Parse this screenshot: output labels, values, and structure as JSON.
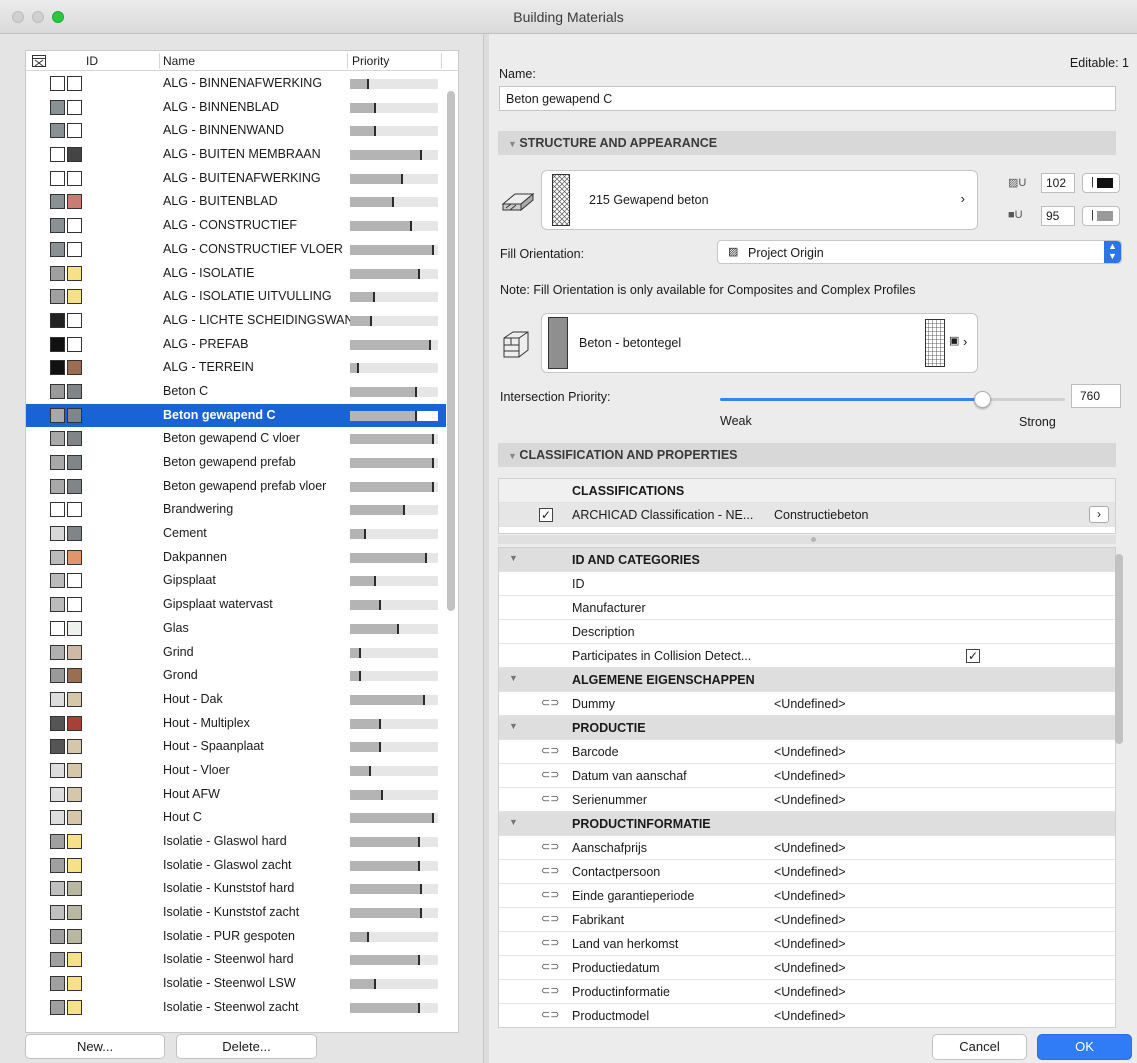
{
  "window": {
    "title": "Building Materials"
  },
  "list": {
    "headers": {
      "id": "ID",
      "name": "Name",
      "priority": "Priority"
    },
    "rows": [
      {
        "name": "ALG - BINNENAFWERKING",
        "c1": "#ffffff",
        "c2": "#ffffff",
        "p": 0.22
      },
      {
        "name": "ALG - BINNENBLAD",
        "c1": "#8a9194",
        "c2": "#ffffff",
        "p": 0.3
      },
      {
        "name": "ALG - BINNENWAND",
        "c1": "#8a9194",
        "c2": "#ffffff",
        "p": 0.3
      },
      {
        "name": "ALG - BUITEN MEMBRAAN",
        "c1": "#ffffff",
        "c2": "#444444",
        "p": 0.82
      },
      {
        "name": "ALG - BUITENAFWERKING",
        "c1": "#ffffff",
        "c2": "#ffffff",
        "p": 0.6
      },
      {
        "name": "ALG - BUITENBLAD",
        "c1": "#8a9194",
        "c2": "#c97c72",
        "p": 0.5
      },
      {
        "name": "ALG - CONSTRUCTIEF",
        "c1": "#8a9194",
        "c2": "#ffffff",
        "p": 0.7
      },
      {
        "name": "ALG - CONSTRUCTIEF VLOER",
        "c1": "#8a9194",
        "c2": "#ffffff",
        "p": 0.95
      },
      {
        "name": "ALG - ISOLATIE",
        "c1": "#a0a0a0",
        "c2": "#f7e08a",
        "p": 0.8
      },
      {
        "name": "ALG - ISOLATIE UITVULLING",
        "c1": "#a0a0a0",
        "c2": "#f7e08a",
        "p": 0.28
      },
      {
        "name": "ALG - LICHTE SCHEIDINGSWAND",
        "c1": "#222222",
        "c2": "#ffffff",
        "p": 0.25
      },
      {
        "name": "ALG - PREFAB",
        "c1": "#111111",
        "c2": "#ffffff",
        "p": 0.92
      },
      {
        "name": "ALG - TERREIN",
        "c1": "#111111",
        "c2": "#9b6d52",
        "p": 0.1
      },
      {
        "name": "Beton C",
        "c1": "#9a9a9a",
        "c2": "#808587",
        "p": 0.76
      },
      {
        "name": "Beton gewapend C",
        "c1": "#a8a8a8",
        "c2": "#808587",
        "p": 0.76
      },
      {
        "name": "Beton gewapend C vloer",
        "c1": "#a8a8a8",
        "c2": "#808587",
        "p": 0.95
      },
      {
        "name": "Beton gewapend prefab",
        "c1": "#a8a8a8",
        "c2": "#808587",
        "p": 0.95
      },
      {
        "name": "Beton gewapend prefab vloer",
        "c1": "#a8a8a8",
        "c2": "#808587",
        "p": 0.95
      },
      {
        "name": "Brandwering",
        "c1": "#ffffff",
        "c2": "#ffffff",
        "p": 0.62
      },
      {
        "name": "Cement",
        "c1": "#d8d8d8",
        "c2": "#808587",
        "p": 0.18
      },
      {
        "name": "Dakpannen",
        "c1": "#bbbbbb",
        "c2": "#e0956a",
        "p": 0.88
      },
      {
        "name": "Gipsplaat",
        "c1": "#bbbbbb",
        "c2": "#ffffff",
        "p": 0.3
      },
      {
        "name": "Gipsplaat watervast",
        "c1": "#bbbbbb",
        "c2": "#ffffff",
        "p": 0.35
      },
      {
        "name": "Glas",
        "c1": "#ffffff",
        "c2": "#eef2ee",
        "p": 0.56
      },
      {
        "name": "Grind",
        "c1": "#b0b0b0",
        "c2": "#cdb9a5",
        "p": 0.12
      },
      {
        "name": "Grond",
        "c1": "#9a9a9a",
        "c2": "#9b6d52",
        "p": 0.12
      },
      {
        "name": "Hout - Dak",
        "c1": "#dddddd",
        "c2": "#d6c7aa",
        "p": 0.85
      },
      {
        "name": "Hout - Multiplex",
        "c1": "#555555",
        "c2": "#a8403a",
        "p": 0.35
      },
      {
        "name": "Hout - Spaanplaat",
        "c1": "#555555",
        "c2": "#d6c7aa",
        "p": 0.35
      },
      {
        "name": "Hout - Vloer",
        "c1": "#dddddd",
        "c2": "#d6c7aa",
        "p": 0.24
      },
      {
        "name": "Hout AFW",
        "c1": "#dddddd",
        "c2": "#d6c7aa",
        "p": 0.38
      },
      {
        "name": "Hout C",
        "c1": "#dddddd",
        "c2": "#d6c7aa",
        "p": 0.95
      },
      {
        "name": "Isolatie - Glaswol hard",
        "c1": "#a0a0a0",
        "c2": "#f7e08a",
        "p": 0.8
      },
      {
        "name": "Isolatie - Glaswol zacht",
        "c1": "#a0a0a0",
        "c2": "#f7e08a",
        "p": 0.8
      },
      {
        "name": "Isolatie - Kunststof hard",
        "c1": "#c0c0c0",
        "c2": "#b8b8a0",
        "p": 0.82
      },
      {
        "name": "Isolatie - Kunststof zacht",
        "c1": "#c0c0c0",
        "c2": "#b8b8a0",
        "p": 0.82
      },
      {
        "name": "Isolatie - PUR gespoten",
        "c1": "#a0a0a0",
        "c2": "#b8b8a0",
        "p": 0.22
      },
      {
        "name": "Isolatie - Steenwol hard",
        "c1": "#a0a0a0",
        "c2": "#f7e08a",
        "p": 0.8
      },
      {
        "name": "Isolatie - Steenwol LSW",
        "c1": "#a0a0a0",
        "c2": "#f7e08a",
        "p": 0.3
      },
      {
        "name": "Isolatie - Steenwol zacht",
        "c1": "#a0a0a0",
        "c2": "#f7e08a",
        "p": 0.8
      }
    ],
    "selected_index": 14,
    "new_label": "New...",
    "delete_label": "Delete..."
  },
  "detail": {
    "editable": "Editable: 1",
    "name_label": "Name:",
    "name_value": "Beton gewapend C",
    "structure_header": "STRUCTURE AND APPEARANCE",
    "cut_fill": "215 Gewapend beton",
    "pen1": "102",
    "pen2": "95",
    "fill_orientation_label": "Fill Orientation:",
    "fill_orientation_value": "Project Origin",
    "note": "Note: Fill Orientation is only available for Composites and Complex Profiles",
    "surface": "Beton - betontegel",
    "intersection_label": "Intersection Priority:",
    "intersection_value": "760",
    "intersection_fraction": 0.76,
    "weak_label": "Weak",
    "strong_label": "Strong",
    "classification_header": "CLASSIFICATION AND PROPERTIES",
    "classifications_title": "CLASSIFICATIONS",
    "classification_system": "ARCHICAD Classification - NE...",
    "classification_value": "Constructiebeton",
    "undefined": "<Undefined>"
  },
  "properties": [
    {
      "group": "ID AND CATEGORIES"
    },
    {
      "name": "ID"
    },
    {
      "name": "Manufacturer"
    },
    {
      "name": "Description"
    },
    {
      "name": "Participates in Collision Detect...",
      "checkbox": true
    },
    {
      "group": "ALGEMENE EIGENSCHAPPEN"
    },
    {
      "name": "Dummy",
      "link": true
    },
    {
      "group": "PRODUCTIE"
    },
    {
      "name": "Barcode",
      "link": true
    },
    {
      "name": "Datum van aanschaf",
      "link": true
    },
    {
      "name": "Serienummer",
      "link": true
    },
    {
      "group": "PRODUCTINFORMATIE"
    },
    {
      "name": "Aanschafprijs",
      "link": true
    },
    {
      "name": "Contactpersoon",
      "link": true
    },
    {
      "name": "Einde garantieperiode",
      "link": true
    },
    {
      "name": "Fabrikant",
      "link": true
    },
    {
      "name": "Land van herkomst",
      "link": true
    },
    {
      "name": "Productiedatum",
      "link": true
    },
    {
      "name": "Productinformatie",
      "link": true
    },
    {
      "name": "Productmodel",
      "link": true
    }
  ],
  "footer": {
    "cancel_label": "Cancel",
    "ok_label": "OK"
  }
}
